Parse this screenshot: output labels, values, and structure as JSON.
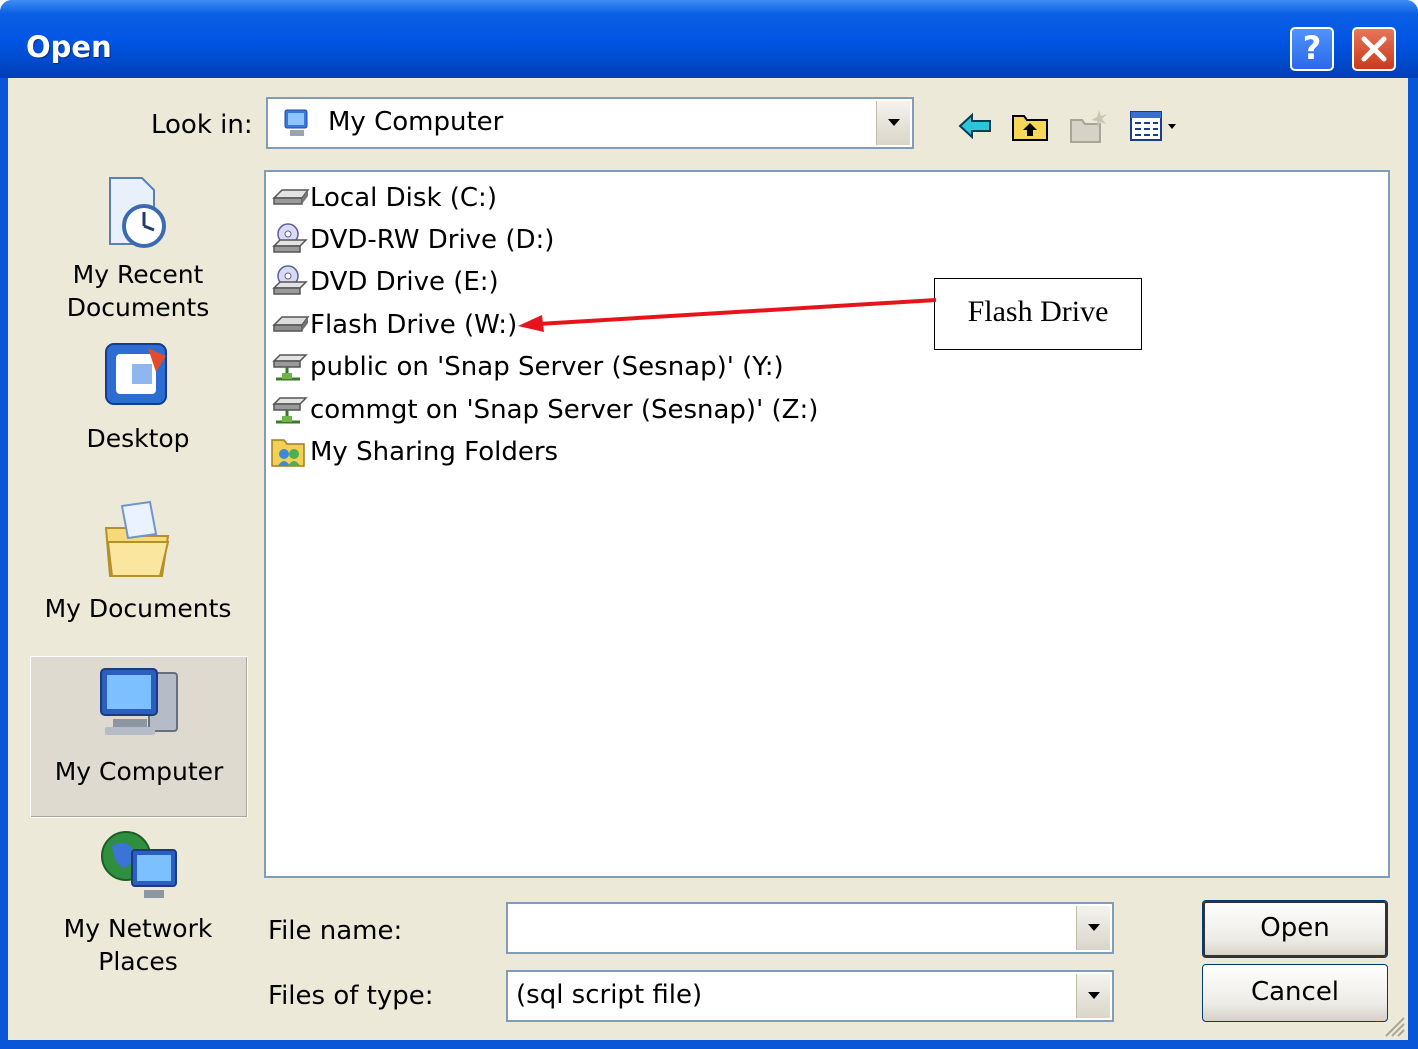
{
  "window": {
    "title": "Open"
  },
  "titlebar_buttons": {
    "help": "?",
    "close": "X"
  },
  "look_in": {
    "label": "Look in:",
    "value": "My Computer"
  },
  "places": [
    {
      "label_line1": "My Recent",
      "label_line2": "Documents"
    },
    {
      "label_line1": "Desktop",
      "label_line2": ""
    },
    {
      "label_line1": "My Documents",
      "label_line2": ""
    },
    {
      "label_line1": "My Computer",
      "label_line2": ""
    },
    {
      "label_line1": "My Network",
      "label_line2": "Places"
    }
  ],
  "files": [
    {
      "name": "Local Disk (C:)",
      "icon": "hard-disk-icon"
    },
    {
      "name": "DVD-RW Drive (D:)",
      "icon": "dvd-drive-icon"
    },
    {
      "name": "DVD Drive (E:)",
      "icon": "dvd-drive-icon"
    },
    {
      "name": "Flash Drive (W:)",
      "icon": "removable-drive-icon"
    },
    {
      "name": "public on 'Snap Server (Sesnap)' (Y:)",
      "icon": "network-drive-icon"
    },
    {
      "name": "commgt on 'Snap Server (Sesnap)' (Z:)",
      "icon": "network-drive-icon"
    },
    {
      "name": "My Sharing Folders",
      "icon": "shared-folder-icon"
    }
  ],
  "file_name": {
    "label": "File name:",
    "value": ""
  },
  "files_of_type": {
    "label": "Files of type:",
    "value": "(sql script file)"
  },
  "buttons": {
    "open": "Open",
    "cancel": "Cancel"
  },
  "annotation": {
    "text": "Flash Drive",
    "arrow_color": "#e8141b"
  }
}
